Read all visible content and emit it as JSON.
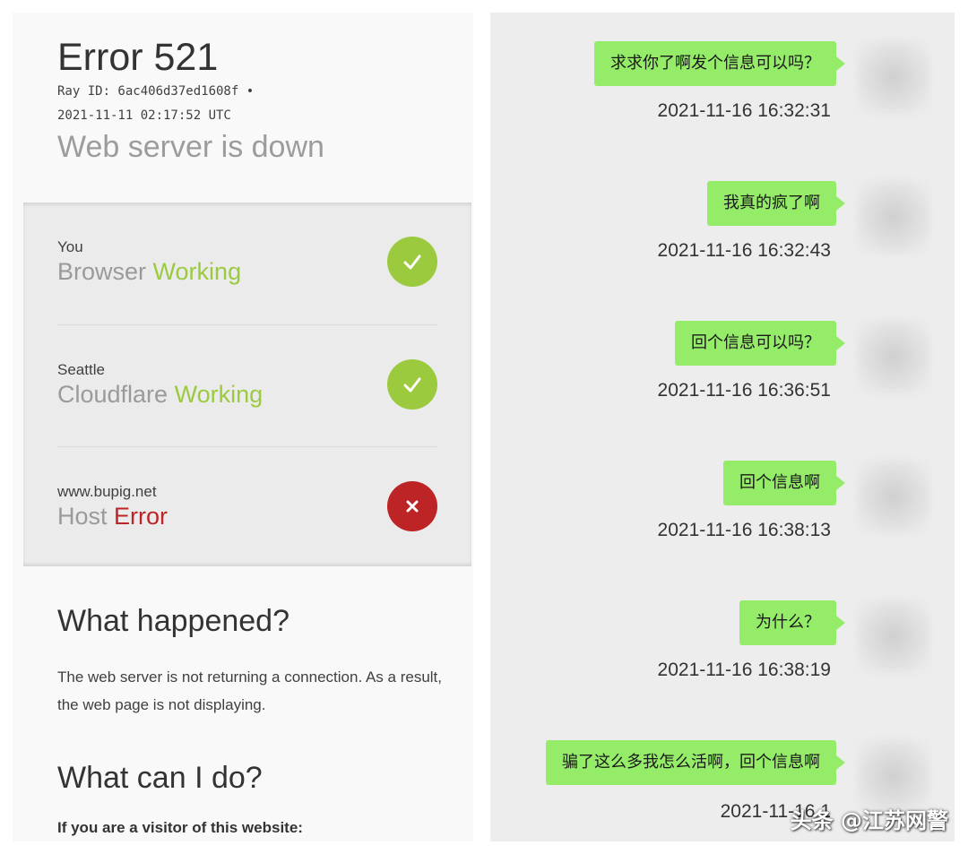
{
  "error_page": {
    "title": "Error 521",
    "ray_line": "Ray ID: 6ac406d37ed1608f •",
    "timestamp": "2021-11-11 02:17:52 UTC",
    "subtitle": "Web server is down",
    "statuses": [
      {
        "location": "You",
        "service": "Browser",
        "state": "Working",
        "result": "ok",
        "icon": "check-icon"
      },
      {
        "location": "Seattle",
        "service": "Cloudflare",
        "state": "Working",
        "result": "ok",
        "icon": "check-icon"
      },
      {
        "location": "www.bupig.net",
        "service": "Host",
        "state": "Error",
        "result": "error",
        "icon": "x-icon"
      }
    ],
    "what_happened_heading": "What happened?",
    "what_happened_text": "The web server is not returning a connection. As a result, the web page is not displaying.",
    "what_can_i_do_heading": "What can I do?",
    "visitor_text": "If you are a visitor of this website:",
    "colors": {
      "working": "#9bca3e",
      "error": "#bd2426"
    }
  },
  "chat": {
    "messages": [
      {
        "text": "求求你了啊发个信息可以吗？",
        "time": "2021-11-16 16:32:31"
      },
      {
        "text": "我真的疯了啊",
        "time": "2021-11-16 16:32:43"
      },
      {
        "text": "回个信息可以吗？",
        "time": "2021-11-16 16:36:51"
      },
      {
        "text": "回个信息啊",
        "time": "2021-11-16 16:38:13"
      },
      {
        "text": "为什么？",
        "time": "2021-11-16 16:38:19"
      },
      {
        "text": "骗了这么多我怎么活啊，回个信息啊",
        "time": "2021-11-16 1"
      }
    ],
    "bubble_color": "#95ec69",
    "watermark": "头条 @江苏网警"
  }
}
